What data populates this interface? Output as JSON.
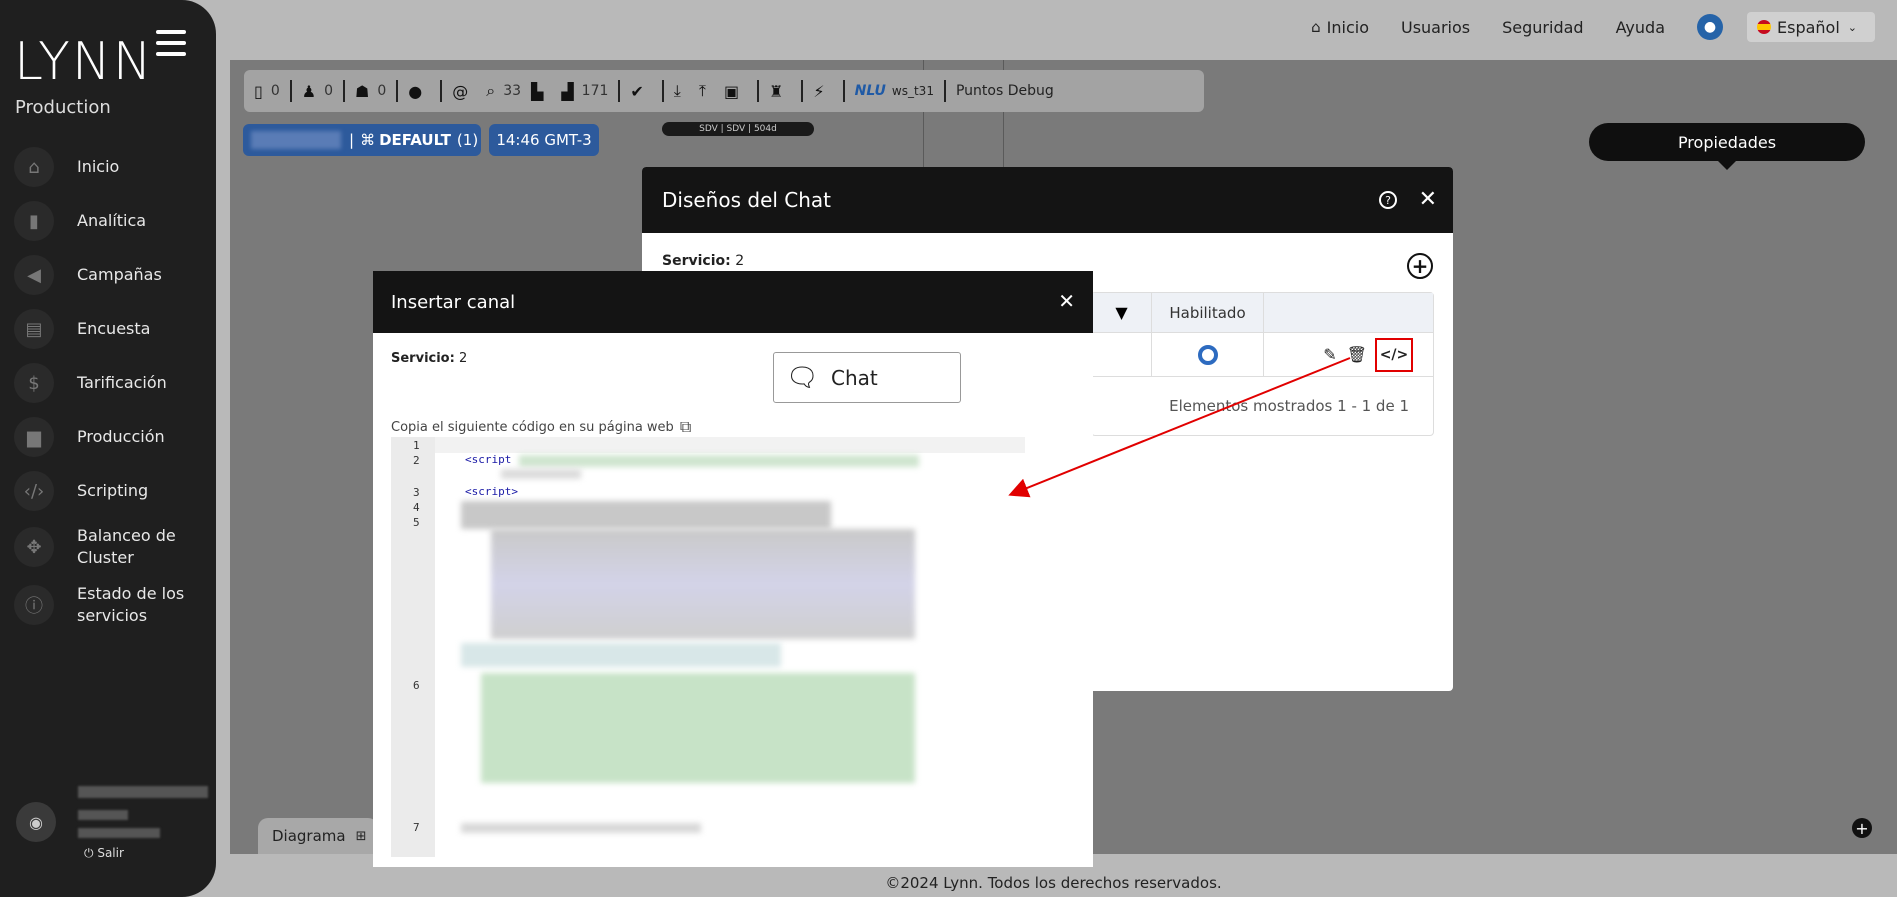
{
  "sidebar": {
    "logo": "LYNN",
    "environment": "Production",
    "items": [
      {
        "label": "Inicio",
        "icon": "home-icon"
      },
      {
        "label": "Analítica",
        "icon": "chart-icon"
      },
      {
        "label": "Campañas",
        "icon": "megaphone-icon"
      },
      {
        "label": "Encuesta",
        "icon": "clipboard-icon"
      },
      {
        "label": "Tarificación",
        "icon": "dollar-icon"
      },
      {
        "label": "Producción",
        "icon": "briefcase-icon"
      },
      {
        "label": "Scripting",
        "icon": "code-icon"
      },
      {
        "label": "Balanceo de Cluster",
        "icon": "network-icon"
      },
      {
        "label": "Estado de los servicios",
        "icon": "info-icon"
      }
    ],
    "logout": "Salir"
  },
  "topnav": {
    "home": "Inicio",
    "users": "Usuarios",
    "security": "Seguridad",
    "help": "Ayuda",
    "language": "Español"
  },
  "toolbar": {
    "counts": [
      "0",
      "0",
      "0",
      "33",
      "171"
    ],
    "nlu": "NLU",
    "ws": "ws_t31",
    "debug": "Puntos Debug"
  },
  "status": {
    "default_label": "DEFAULT",
    "default_count": "(1)",
    "time": "14:46 GMT-3",
    "node_text": "SDV | SDV | 504d"
  },
  "properties_label": "Propiedades",
  "diagram_tab": "Diagrama",
  "footer": "©2024 Lynn. Todos los derechos reservados.",
  "chat_dialog": {
    "title": "Diseños del Chat",
    "servicio_label": "Servicio:",
    "servicio_value": "2",
    "col_enabled": "Habilitado",
    "items_shown": "Elementos mostrados 1 - 1 de 1",
    "code_btn": "</>"
  },
  "insert_dialog": {
    "title": "Insertar canal",
    "servicio_label": "Servicio:",
    "servicio_value": "2",
    "chat_button": "Chat",
    "copy_instructions": "Copia el siguiente código en su página web",
    "code_line_numbers": [
      "1",
      "2",
      "3",
      "4",
      "5",
      "6",
      "7"
    ],
    "code_tokens": [
      "<script",
      "<script>"
    ]
  },
  "colors": {
    "accent_blue": "#2d5a9c",
    "annotation_red": "#e10000"
  }
}
